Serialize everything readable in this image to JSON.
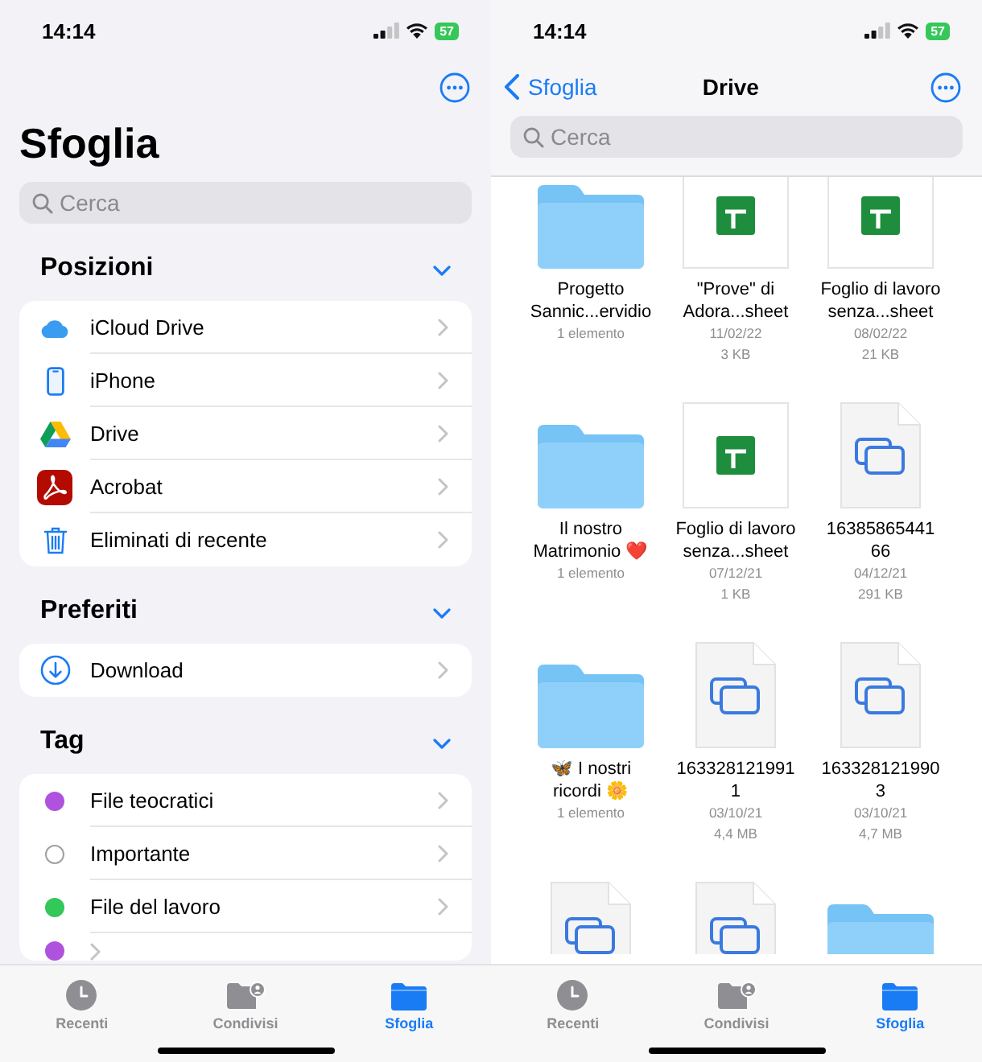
{
  "browse_screen": {
    "status_bar": {
      "time": "14:14",
      "battery": "57"
    },
    "title": "Sfoglia",
    "search": {
      "placeholder": "Cerca"
    },
    "sections": [
      {
        "title": "Posizioni",
        "expanded": true,
        "items": [
          {
            "label": "iCloud Drive",
            "kind": "cloud"
          },
          {
            "label": "iPhone",
            "kind": "phone"
          },
          {
            "label": "Drive",
            "kind": "triangle"
          },
          {
            "label": "Acrobat",
            "kind": "app"
          },
          {
            "label": "Eliminati di recente",
            "kind": "trash"
          }
        ]
      },
      {
        "title": "Preferiti",
        "expanded": true,
        "items": [
          {
            "label": "Download",
            "kind": "download"
          }
        ]
      },
      {
        "title": "Tag",
        "expanded": true,
        "items": [
          {
            "label": "File teocratici",
            "kind": "tag",
            "color": "#af52de"
          },
          {
            "label": "Importante",
            "kind": "tag-empty"
          },
          {
            "label": "File del lavoro",
            "kind": "tag",
            "color": "#34c759"
          },
          {
            "kind": "tag",
            "color": "#af52de"
          }
        ]
      }
    ],
    "tab_bar": [
      {
        "label": "Recenti",
        "kind": "clock",
        "selected": false
      },
      {
        "label": "Condivisi",
        "kind": "shared",
        "selected": false
      },
      {
        "label": "Sfoglia",
        "kind": "folder",
        "selected": true
      }
    ]
  },
  "drive_screen": {
    "status_bar": {
      "time": "14:14",
      "battery": "57"
    },
    "back": "Sfoglia",
    "title": "Drive",
    "search": {
      "placeholder": "Cerca"
    },
    "items": [
      {
        "kind": "folder",
        "name": "Progetto\nSannic...ervidio",
        "meta": [
          "1 elemento"
        ]
      },
      {
        "kind": "sheet",
        "name": "\"Prove\" di\nAdora...sheet",
        "meta": [
          "11/02/22",
          "3 KB"
        ]
      },
      {
        "kind": "sheet",
        "name": "Foglio di lavoro\nsenza...sheet",
        "meta": [
          "08/02/22",
          "21 KB"
        ]
      },
      {
        "kind": "folder",
        "name": "Il nostro\nMatrimonio ❤️",
        "meta": [
          "1 elemento"
        ]
      },
      {
        "kind": "sheet",
        "name": "Foglio di lavoro\nsenza...sheet",
        "meta": [
          "07/12/21",
          "1 KB"
        ]
      },
      {
        "kind": "doc",
        "name": "16385865441\n66",
        "meta": [
          "04/12/21",
          "291 KB"
        ]
      },
      {
        "kind": "folder",
        "name": "🦋 I nostri\nricordi 🌼",
        "meta": [
          "1 elemento"
        ]
      },
      {
        "kind": "doc",
        "name": "163328121991\n1",
        "meta": [
          "03/10/21",
          "4,4 MB"
        ]
      },
      {
        "kind": "doc",
        "name": "163328121990\n3",
        "meta": [
          "03/10/21",
          "4,7 MB"
        ]
      },
      {
        "kind": "doc"
      },
      {
        "kind": "doc"
      },
      {
        "kind": "folder"
      }
    ],
    "tab_bar": [
      {
        "label": "Recenti",
        "kind": "clock",
        "selected": false
      },
      {
        "label": "Condivisi",
        "kind": "shared",
        "selected": false
      },
      {
        "label": "Sfoglia",
        "kind": "folder",
        "selected": true
      }
    ]
  }
}
